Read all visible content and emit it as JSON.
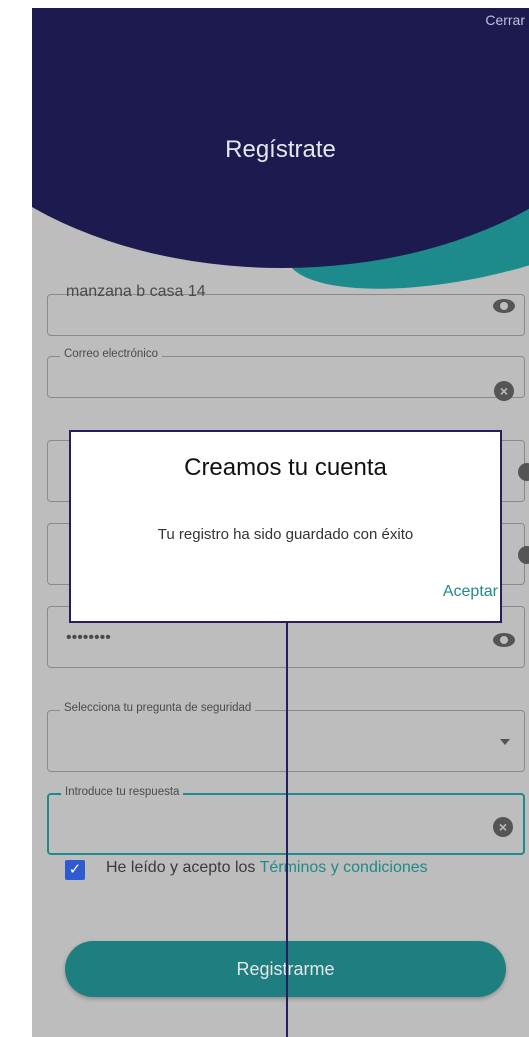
{
  "header": {
    "close_label": "Cerrar",
    "title": "Regístrate"
  },
  "fields": {
    "address_value": "manzana b casa 14",
    "email_label": "Correo electrónico",
    "password_value": "••••••••",
    "question_label": "Selecciona tu pregunta de seguridad",
    "answer_label": "Introduce tu respuesta"
  },
  "terms": {
    "prefix": "He leído y acepto los ",
    "link": "Términos y condiciones",
    "checked": true
  },
  "register_label": "Registrarme",
  "dialog": {
    "title": "Creamos tu cuenta",
    "message": "Tu registro ha sido guardado con éxito",
    "accept_label": "Aceptar"
  },
  "colors": {
    "navy": "#1c1a4f",
    "teal": "#1f8a8a",
    "checkbox_blue": "#2f5bd0"
  }
}
